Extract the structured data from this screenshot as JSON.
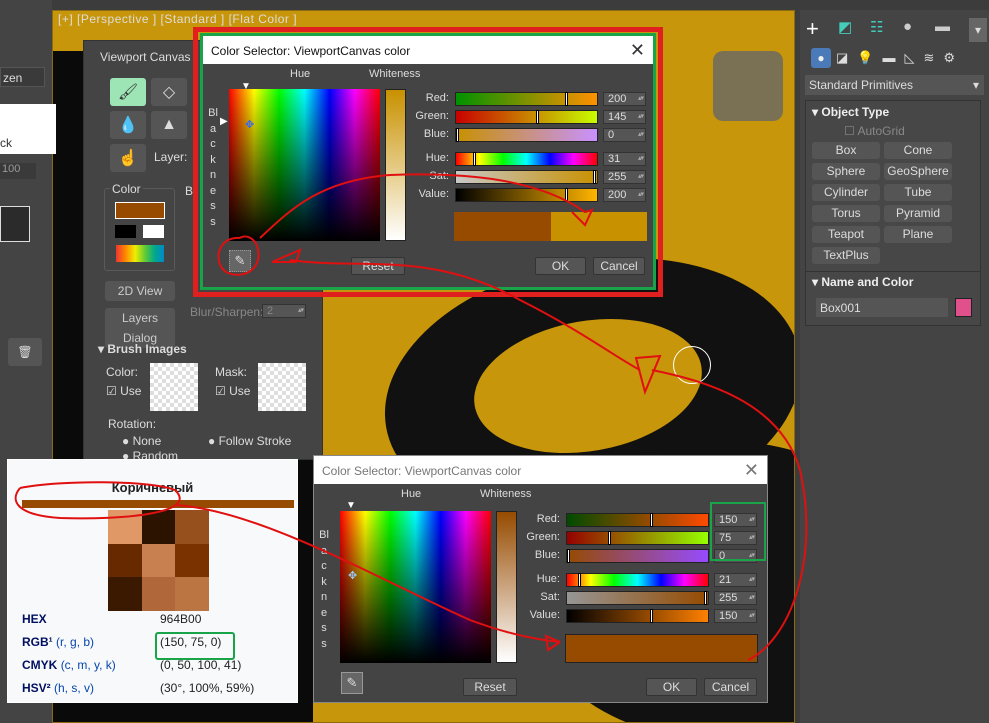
{
  "viewport": {
    "label": "[+] [Perspective ] [Standard ] [Flat Color ]"
  },
  "left_panel": {
    "partial_label": "zen",
    "partial_text": "ck",
    "spinner": "100"
  },
  "viewport_canvas": {
    "title": "Viewport Canvas",
    "layer_label": "Layer:",
    "color_label": "Color",
    "primary_color": "#964b00",
    "view_2d": "2D View",
    "layers_dialog": "Layers Dialog",
    "blur_label": "Blur/Sharpen:",
    "blur_value": "2",
    "brush_images": "Brush Images",
    "color_img_label": "Color:",
    "mask_img_label": "Mask:",
    "use_label": "Use",
    "rotation_label": "Rotation:",
    "rot_none": "None",
    "rot_follow": "Follow Stroke",
    "rot_random": "Random",
    "b_label": "B"
  },
  "dialog1": {
    "title": "Color Selector: ViewportCanvas color",
    "hue": "Hue",
    "whiteness": "Whiteness",
    "blackness": "Blackness",
    "rows": [
      {
        "label": "Red:",
        "value": "200"
      },
      {
        "label": "Green:",
        "value": "145"
      },
      {
        "label": "Blue:",
        "value": "0"
      },
      {
        "label": "Hue:",
        "value": "31"
      },
      {
        "label": "Sat:",
        "value": "255"
      },
      {
        "label": "Value:",
        "value": "200"
      }
    ],
    "old_color": "#964b00",
    "new_color": "#c89100",
    "reset": "Reset",
    "ok": "OK",
    "cancel": "Cancel"
  },
  "dialog2": {
    "title": "Color Selector: ViewportCanvas color",
    "hue": "Hue",
    "whiteness": "Whiteness",
    "blackness": "Blackness",
    "rows": [
      {
        "label": "Red:",
        "value": "150"
      },
      {
        "label": "Green:",
        "value": "75"
      },
      {
        "label": "Blue:",
        "value": "0"
      },
      {
        "label": "Hue:",
        "value": "21"
      },
      {
        "label": "Sat:",
        "value": "255"
      },
      {
        "label": "Value:",
        "value": "150"
      }
    ],
    "color": "#964b00",
    "reset": "Reset",
    "ok": "OK",
    "cancel": "Cancel"
  },
  "right_panel": {
    "dropdown": "Standard Primitives",
    "object_type": "Object Type",
    "autogrid": "AutoGrid",
    "buttons": [
      "Box",
      "Cone",
      "Sphere",
      "GeoSphere",
      "Cylinder",
      "Tube",
      "Torus",
      "Pyramid",
      "Teapot",
      "Plane",
      "TextPlus"
    ],
    "name_and_color": "Name and Color",
    "object_name": "Box001",
    "object_color": "#e0508a"
  },
  "wiki": {
    "title": "Коричневый",
    "color": "#964b00",
    "swatches": [
      "#e09966",
      "#2b1300",
      "#96501e",
      "#662900",
      "#c88050",
      "#7a3300",
      "#3b1800",
      "#b0683a",
      "#ba7542"
    ],
    "rows": [
      {
        "key": "HEX",
        "sub": "",
        "value": "964B00"
      },
      {
        "key": "RGB¹",
        "sub": "(r, g, b)",
        "value": "(150, 75, 0)"
      },
      {
        "key": "CMYK",
        "sub": "(c, m, y, k)",
        "value": "(0, 50, 100, 41)"
      },
      {
        "key": "HSV²",
        "sub": "(h, s, v)",
        "value": "(30°, 100%, 59%)"
      }
    ]
  }
}
